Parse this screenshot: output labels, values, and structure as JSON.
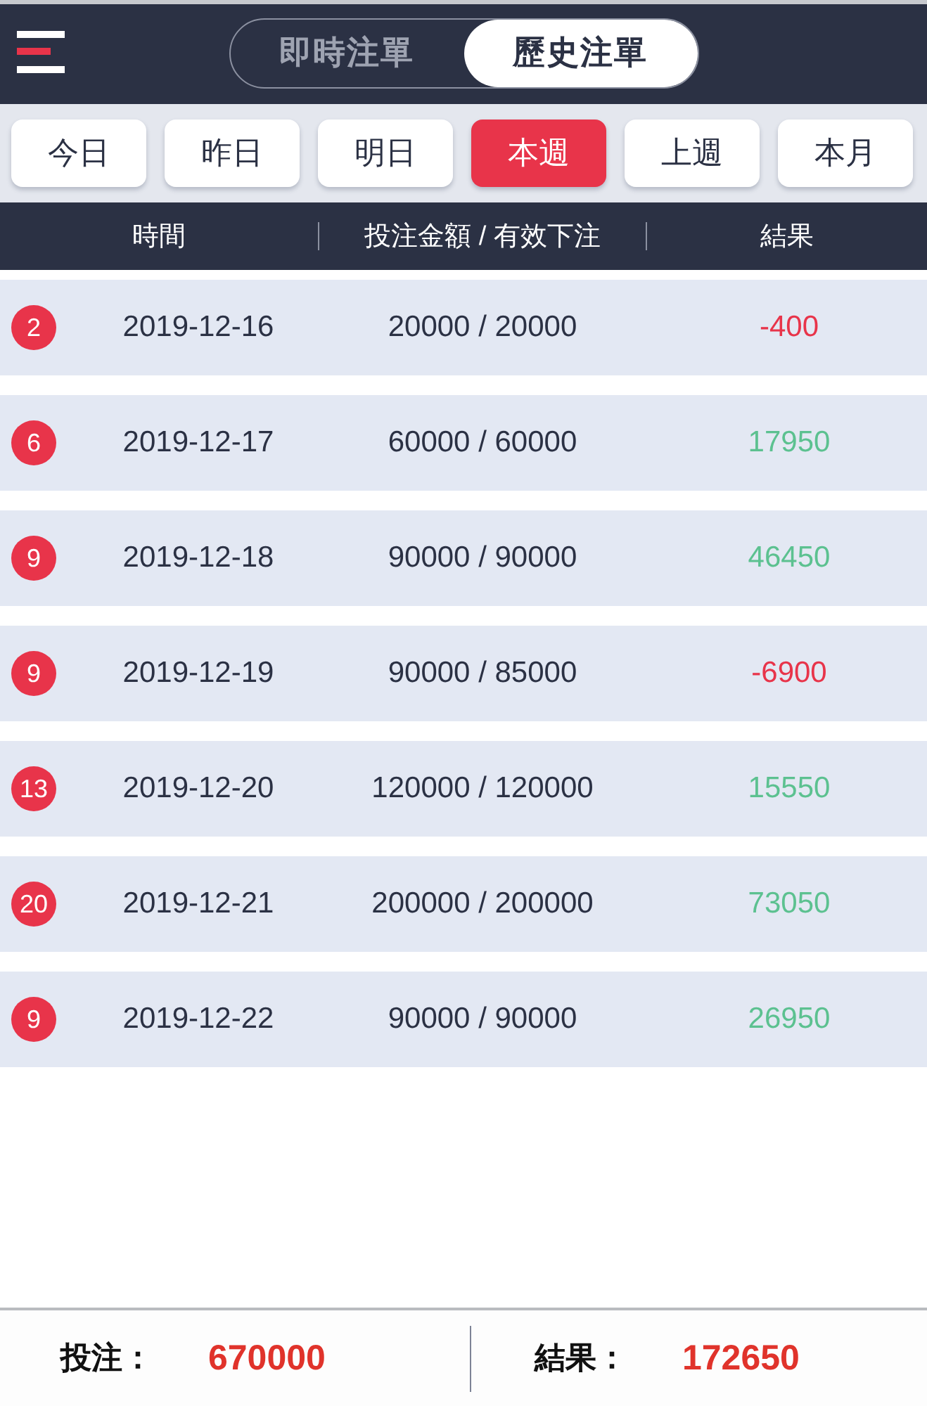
{
  "header": {
    "segments": [
      {
        "label": "即時注單",
        "selected": false
      },
      {
        "label": "歷史注單",
        "selected": true
      }
    ]
  },
  "filters": [
    {
      "label": "今日",
      "selected": false
    },
    {
      "label": "昨日",
      "selected": false
    },
    {
      "label": "明日",
      "selected": false
    },
    {
      "label": "本週",
      "selected": true
    },
    {
      "label": "上週",
      "selected": false
    },
    {
      "label": "本月",
      "selected": false
    }
  ],
  "table": {
    "columns": [
      "時間",
      "投注金額 / 有效下注",
      "結果"
    ],
    "rows": [
      {
        "count": "2",
        "date": "2019-12-16",
        "amounts": "20000 / 20000",
        "result": "-400",
        "color": "#e8344a"
      },
      {
        "count": "6",
        "date": "2019-12-17",
        "amounts": "60000 / 60000",
        "result": "17950",
        "color": "#5cc190"
      },
      {
        "count": "9",
        "date": "2019-12-18",
        "amounts": "90000 / 90000",
        "result": "46450",
        "color": "#5cc190"
      },
      {
        "count": "9",
        "date": "2019-12-19",
        "amounts": "90000 / 85000",
        "result": "-6900",
        "color": "#e8344a"
      },
      {
        "count": "13",
        "date": "2019-12-20",
        "amounts": "120000 / 120000",
        "result": "15550",
        "color": "#5cc190"
      },
      {
        "count": "20",
        "date": "2019-12-21",
        "amounts": "200000 / 200000",
        "result": "73050",
        "color": "#5cc190"
      },
      {
        "count": "9",
        "date": "2019-12-22",
        "amounts": "90000 / 90000",
        "result": "26950",
        "color": "#5cc190"
      }
    ]
  },
  "footer": {
    "bet_label": "投注：",
    "bet_value": "670000",
    "result_label": "結果：",
    "result_value": "172650"
  }
}
